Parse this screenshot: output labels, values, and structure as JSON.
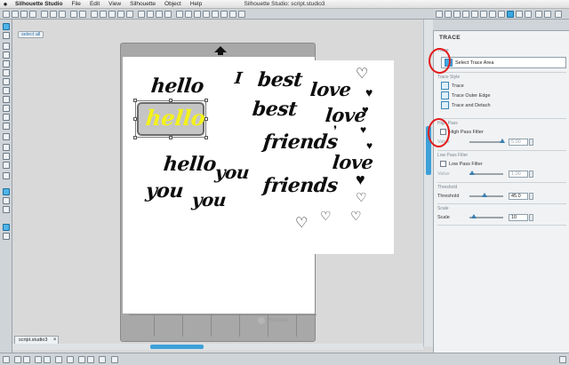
{
  "menubar": {
    "apple": "",
    "app": "Silhouette Studio",
    "items": [
      "File",
      "Edit",
      "View",
      "Silhouette",
      "Object",
      "Help"
    ],
    "window_title": "Silhouette Studio: script.studio3"
  },
  "canvas": {
    "zoom_tab": "select all",
    "words": [
      "hello",
      "best",
      "love",
      "best",
      "love",
      "hello",
      "friends",
      "hello",
      "you",
      "love",
      "you",
      "you",
      "friends"
    ],
    "selected_word": "hello",
    "brand": "silhouette"
  },
  "doc_tab": {
    "name": "script.studio3",
    "close": "×"
  },
  "panel": {
    "title": "TRACE",
    "sec_trace": "Trace",
    "select_trace_area": "Select Trace Area",
    "sec_style": "Trace Style",
    "trace": "Trace",
    "trace_outer_edge": "Trace Outer Edge",
    "trace_and_detach": "Trace and Detach",
    "sec_high_pass": "High Pass",
    "high_pass_filter": "High Pass Filter",
    "high_pass_value_label": "Value",
    "high_pass_value": "5.00",
    "sec_low_pass": "Low Pass Filter",
    "low_pass_filter": "Low Pass Filter",
    "low_pass_value_label": "Value",
    "low_pass_value": "1.00",
    "sec_threshold": "Threshold",
    "threshold_label": "Threshold",
    "threshold_value": "45.0",
    "threshold_level": 0.45,
    "sec_scale": "Scale",
    "scale_label": "Scale",
    "scale_value": "10",
    "highlight_color": "#e21b1b",
    "accent_color": "#3da0d8"
  }
}
